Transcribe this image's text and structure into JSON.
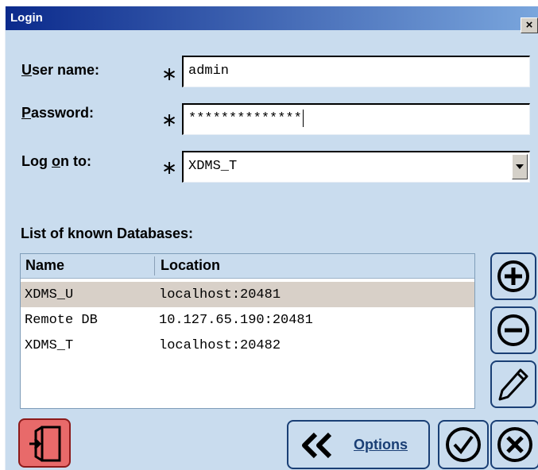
{
  "window": {
    "title": "Login",
    "close_glyph": "×"
  },
  "form": {
    "user": {
      "label_underlined": "U",
      "label_rest": "ser name:",
      "value": "admin"
    },
    "password": {
      "label_underlined": "P",
      "label_rest": "assword:",
      "value": "**************"
    },
    "logon": {
      "label_before": "Log ",
      "label_underlined": "o",
      "label_after": "n to:",
      "value": "XDMS_T"
    },
    "required_marker": "∗"
  },
  "databases": {
    "section_title": "List of known Databases:",
    "columns": [
      "Name",
      "Location"
    ],
    "rows": [
      {
        "name": "XDMS_U",
        "location": "localhost:20481",
        "selected": true
      },
      {
        "name": "Remote DB",
        "location": "10.127.65.190:20481",
        "selected": false
      },
      {
        "name": "XDMS_T",
        "location": "localhost:20482",
        "selected": false
      }
    ]
  },
  "buttons": {
    "add": "plus-circle-icon",
    "remove": "minus-circle-icon",
    "edit": "pencil-icon",
    "exit": "exit-door-icon",
    "options": {
      "label": "Options"
    },
    "ok": "check-circle-icon",
    "cancel": "x-circle-icon"
  },
  "colors": {
    "background": "#c9dcee",
    "titlebar_start": "#0b2a8c",
    "titlebar_end": "#7aa6dd",
    "button_border": "#1a3f75",
    "exit_button": "#e86a6a",
    "selected_row": "#d8d0c8"
  }
}
